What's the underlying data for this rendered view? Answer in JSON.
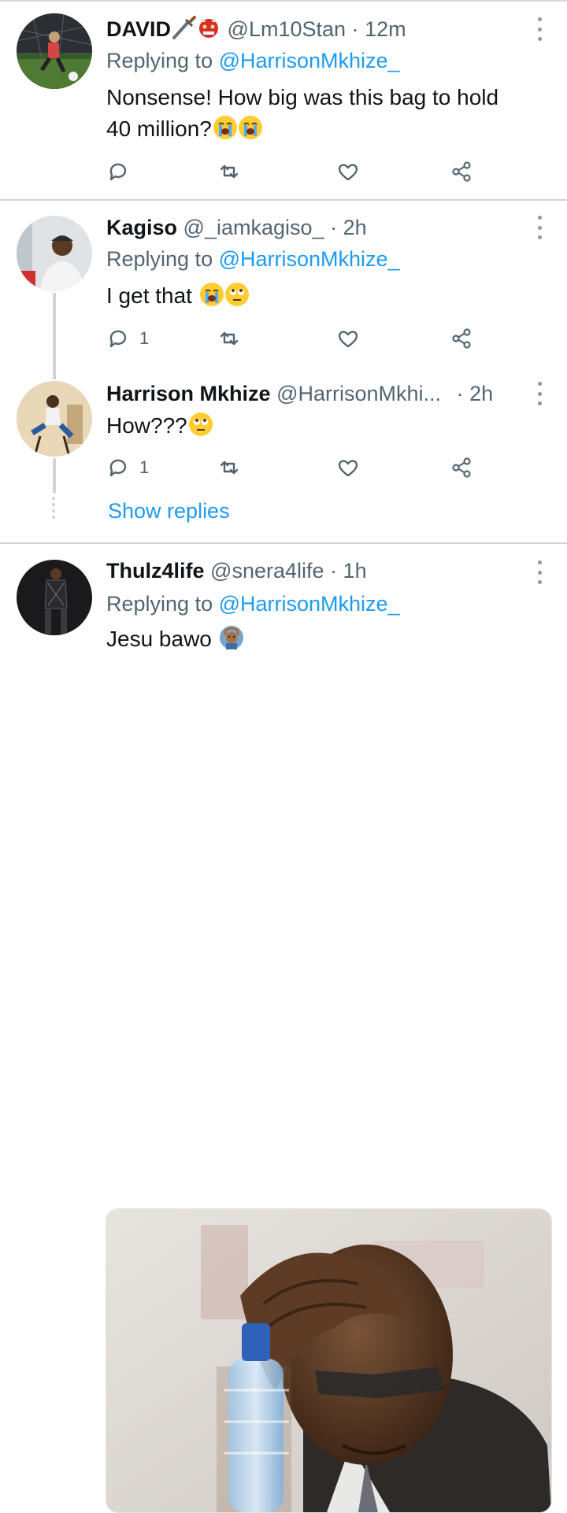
{
  "tweets": [
    {
      "display_name": "DAVID",
      "handle": "@Lm10Stan",
      "dot": "·",
      "time": "12m",
      "replying_prefix": "Replying to ",
      "replying_to": "@HarrisonMkhize_",
      "text_line1": "Nonsense! How big was this bag to hold",
      "text_line2": "40 million?",
      "reply_count": "",
      "header_emoji": [
        "dagger-icon",
        "ogre-icon"
      ],
      "text_emoji": [
        "loudly-crying-face-icon",
        "loudly-crying-face-icon"
      ]
    },
    {
      "display_name": "Kagiso",
      "handle": "@_iamkagiso_",
      "dot": "·",
      "time": "2h",
      "replying_prefix": "Replying to ",
      "replying_to": "@HarrisonMkhize_",
      "text": "I get that ",
      "reply_count": "1",
      "text_emoji": [
        "loudly-crying-face-icon",
        "face-with-rolling-eyes-icon"
      ]
    },
    {
      "display_name": "Harrison Mkhize",
      "handle": "@HarrisonMkhi...",
      "dot": "·",
      "time": "2h",
      "text": "How???",
      "reply_count": "1",
      "text_emoji": [
        "face-with-rolling-eyes-icon"
      ]
    },
    {
      "display_name": "Thulz4life",
      "handle": "@snera4life",
      "dot": "·",
      "time": "1h",
      "replying_prefix": "Replying to ",
      "replying_to": "@HarrisonMkhize_",
      "text": "Jesu bawo ",
      "text_emoji": [
        "person-gesturing-ok-icon"
      ]
    }
  ],
  "show_replies": "Show replies",
  "colors": {
    "accent": "#1d9bf0",
    "secondary_text": "#536471",
    "primary_text": "#0f1419",
    "divider": "#cfd4d8"
  },
  "action_icons": [
    "reply-icon",
    "retweet-icon",
    "like-icon",
    "share-icon"
  ]
}
